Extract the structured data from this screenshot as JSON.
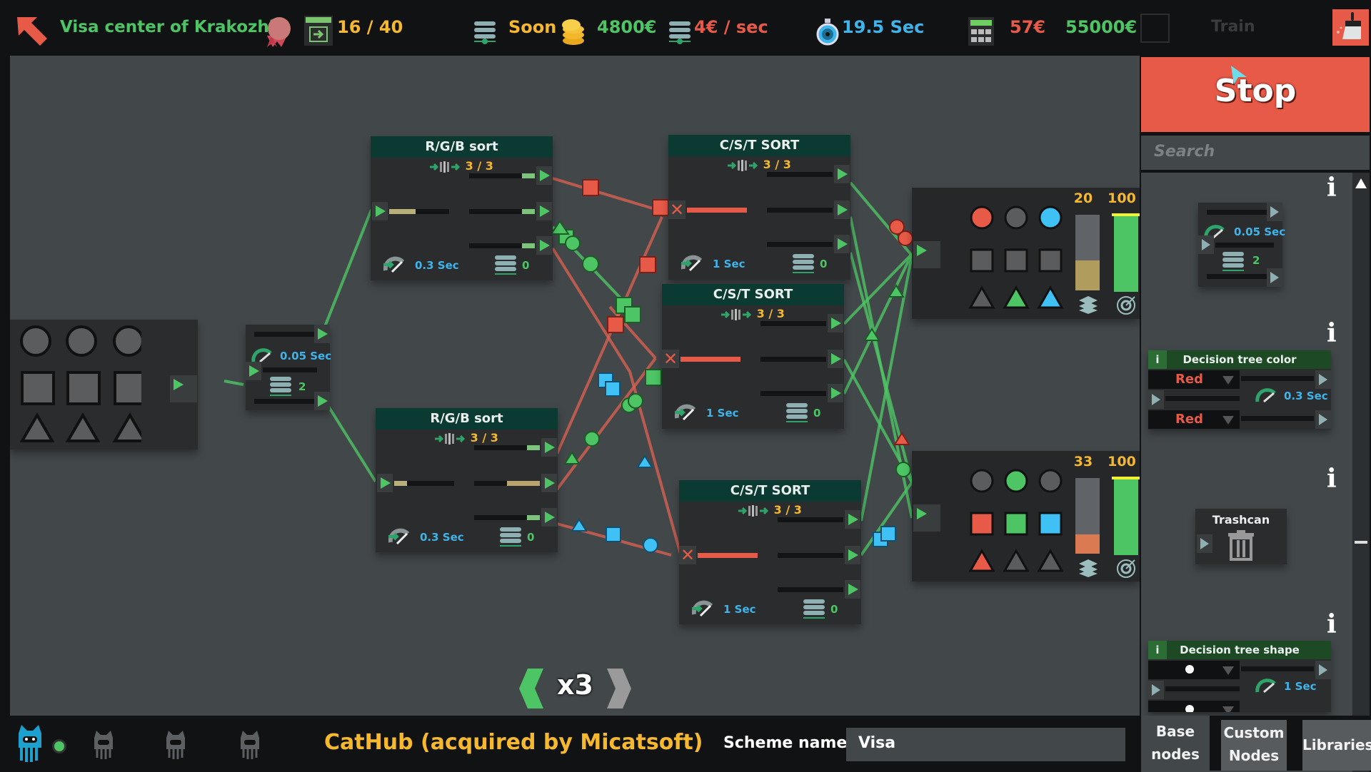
{
  "topbar": {
    "level_title": "Visa center of Krakozhia",
    "progress": "16 / 40",
    "status": "Soon",
    "money": "4800€",
    "income": "4€ / sec",
    "timer": "19.5 Sec",
    "cost": "57€",
    "budget": "55000€",
    "train_label": "Train",
    "icons": [
      "back-arrow-icon",
      "medal-icon",
      "exit-door-icon",
      "server-stack-icon",
      "coins-icon",
      "server-stack-icon",
      "stopwatch-icon",
      "calculator-icon",
      "broom-icon"
    ]
  },
  "right_panel": {
    "stop_label": "Stop",
    "search_placeholder": "Search",
    "splitter_node": {
      "time": "0.05 Sec",
      "count": "2"
    },
    "decision_color": {
      "title": "Decision tree color",
      "select1": "Red",
      "select2": "Red",
      "time": "0.3 Sec"
    },
    "trashcan": {
      "title": "Trashcan"
    },
    "decision_shape": {
      "title": "Decision tree shape",
      "time": "1 Sec"
    },
    "info_label": "i",
    "tabs": {
      "base": [
        "Base",
        "nodes"
      ],
      "custom": [
        "Custom",
        "Nodes"
      ],
      "libraries": "Libraries"
    }
  },
  "canvas": {
    "source_node": {
      "shapes": [
        "circle",
        "circle",
        "circle",
        "square",
        "square",
        "square",
        "triangle",
        "triangle",
        "triangle"
      ]
    },
    "splitter": {
      "time": "0.05 Sec",
      "count": "2"
    },
    "rgb_sort_1": {
      "title": "R/G/B sort",
      "capacity": "3 / 3",
      "time": "0.3 Sec",
      "queue": "0",
      "input_fill": 0.3
    },
    "rgb_sort_2": {
      "title": "R/G/B sort",
      "capacity": "3 / 3",
      "time": "0.3 Sec",
      "queue": "0",
      "input_fill": 0.15,
      "output2_fill": 0.5
    },
    "cst_sort_1": {
      "title": "C/S/T SORT",
      "capacity": "3 / 3",
      "time": "1 Sec",
      "queue": "0"
    },
    "cst_sort_2": {
      "title": "C/S/T SORT",
      "capacity": "3 / 3",
      "time": "1 Sec",
      "queue": "0"
    },
    "cst_sort_3": {
      "title": "C/S/T SORT",
      "capacity": "3 / 3",
      "time": "1 Sec",
      "queue": "0"
    },
    "output_1": {
      "stack_value": "20",
      "target_value": "100",
      "stack_fill": 0.4,
      "target_fill": 1.0,
      "active": [
        "red-circle",
        "blue-circle",
        "green-triangle",
        "blue-triangle"
      ]
    },
    "output_2": {
      "stack_value": "33",
      "target_value": "100",
      "stack_fill": 0.25,
      "target_fill": 1.0,
      "active": [
        "green-circle",
        "red-square",
        "green-square",
        "blue-square",
        "red-triangle"
      ]
    },
    "speed": "x3"
  },
  "bottombar": {
    "title": "CatHub (acquired by Micatsoft)",
    "scheme_label": "Scheme name :",
    "scheme_value": "Visa"
  },
  "colors": {
    "red": "#e85a48",
    "green": "#4ec564",
    "blue": "#3fc1f5",
    "yellow": "#f5b82e",
    "stop": "#e85a48"
  }
}
